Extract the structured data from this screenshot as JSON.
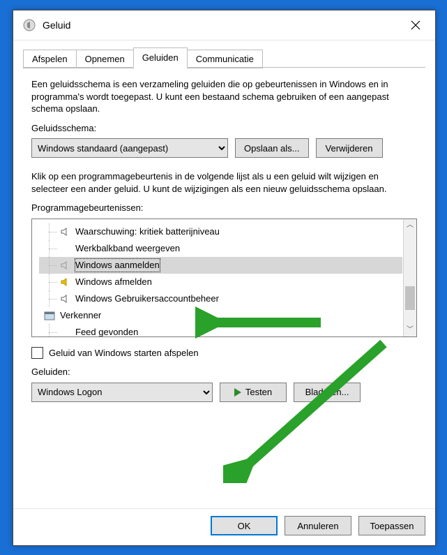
{
  "window": {
    "title": "Geluid"
  },
  "tabs": [
    {
      "label": "Afspelen",
      "active": false
    },
    {
      "label": "Opnemen",
      "active": false
    },
    {
      "label": "Geluiden",
      "active": true
    },
    {
      "label": "Communicatie",
      "active": false
    }
  ],
  "description": "Een geluidsschema is een verzameling geluiden die op gebeurtenissen in Windows en in programma's wordt toegepast.  U kunt een bestaand schema gebruiken of een aangepast schema opslaan.",
  "scheme": {
    "label": "Geluidsschema:",
    "value": "Windows standaard (aangepast)",
    "save_label": "Opslaan als...",
    "delete_label": "Verwijderen"
  },
  "events_help": "Klik op een programmagebeurtenis in de volgende lijst als u een geluid wilt wijzigen en selecteer een ander geluid. U kunt de wijzigingen als een nieuw geluidsschema opslaan.",
  "events_label": "Programmagebeurtenissen:",
  "events": [
    {
      "label": "Waarschuwing: kritiek batterijniveau",
      "icon": "speaker",
      "selected": false,
      "depth": 1
    },
    {
      "label": "Werkbalkband weergeven",
      "icon": "none",
      "selected": false,
      "depth": 1
    },
    {
      "label": "Windows aanmelden",
      "icon": "speaker-muted",
      "selected": true,
      "depth": 1
    },
    {
      "label": "Windows afmelden",
      "icon": "speaker-yellow",
      "selected": false,
      "depth": 1
    },
    {
      "label": "Windows Gebruikersaccountbeheer",
      "icon": "speaker",
      "selected": false,
      "depth": 1
    },
    {
      "label": "Verkenner",
      "icon": "explorer",
      "selected": false,
      "depth": 0
    },
    {
      "label": "Feed gevonden",
      "icon": "none",
      "selected": false,
      "depth": 1
    }
  ],
  "play_startup": {
    "checked": false,
    "label": "Geluid van Windows starten afspelen"
  },
  "sounds": {
    "label": "Geluiden:",
    "value": "Windows Logon",
    "test_label": "Testen",
    "browse_label": "Bladeren..."
  },
  "footer": {
    "ok": "OK",
    "cancel": "Annuleren",
    "apply": "Toepassen"
  },
  "annotation_color": "#2aa12a"
}
